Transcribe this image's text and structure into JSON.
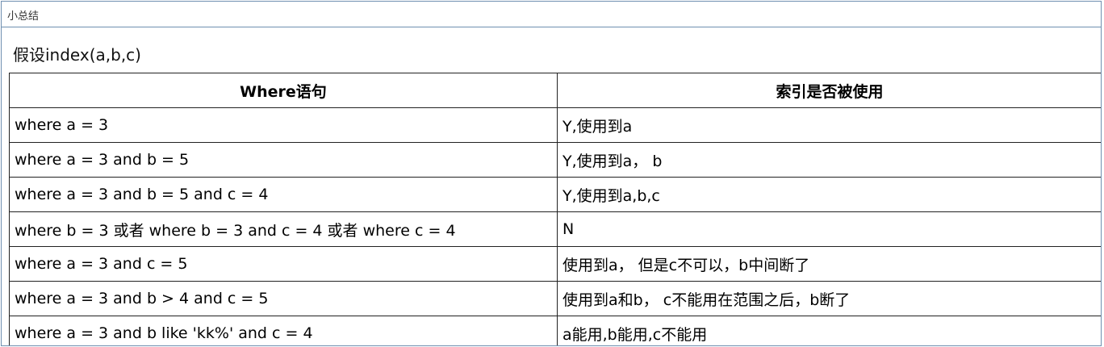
{
  "window": {
    "title": "小总结"
  },
  "assumption": "假设index(a,b,c)",
  "table": {
    "headers": [
      "Where语句",
      "索引是否被使用"
    ],
    "rows": [
      [
        "where a = 3",
        "Y,使用到a"
      ],
      [
        "where a = 3 and b = 5",
        "Y,使用到a， b"
      ],
      [
        "where a = 3 and b = 5 and c = 4",
        "Y,使用到a,b,c"
      ],
      [
        "where b = 3 或者 where b = 3 and c = 4  或者 where c = 4",
        "N"
      ],
      [
        "where a = 3 and c = 5",
        "使用到a， 但是c不可以，b中间断了"
      ],
      [
        "where a = 3 and b > 4 and c = 5",
        "使用到a和b， c不能用在范围之后，b断了"
      ],
      [
        "where a = 3 and b like 'kk%' and c = 4",
        "a能用,b能用,c不能用"
      ]
    ]
  }
}
